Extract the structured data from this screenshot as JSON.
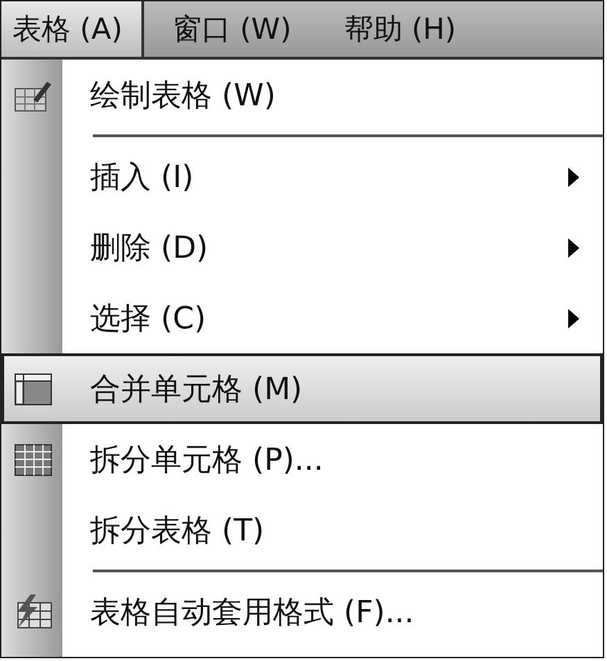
{
  "menubar": [
    {
      "label": "表格 (A)",
      "selected": true
    },
    {
      "label": "窗口 (W)",
      "selected": false
    },
    {
      "label": "帮助 (H)",
      "selected": false
    }
  ],
  "menu": {
    "items": [
      {
        "kind": "draw",
        "label": "绘制表格 (W)",
        "submenu": false,
        "selected": false
      },
      {
        "kind": "separator"
      },
      {
        "kind": "plain",
        "label": "插入 (I)",
        "submenu": true,
        "selected": false
      },
      {
        "kind": "plain",
        "label": "删除 (D)",
        "submenu": true,
        "selected": false
      },
      {
        "kind": "plain",
        "label": "选择 (C)",
        "submenu": true,
        "selected": false
      },
      {
        "kind": "merge",
        "label": "合并单元格 (M)",
        "submenu": false,
        "selected": true
      },
      {
        "kind": "split",
        "label": "拆分单元格 (P)...",
        "submenu": false,
        "selected": false
      },
      {
        "kind": "plain",
        "label": "拆分表格 (T)",
        "submenu": false,
        "selected": false
      },
      {
        "kind": "separator"
      },
      {
        "kind": "autoformat",
        "label": "表格自动套用格式 (F)...",
        "submenu": false,
        "selected": false
      }
    ]
  }
}
